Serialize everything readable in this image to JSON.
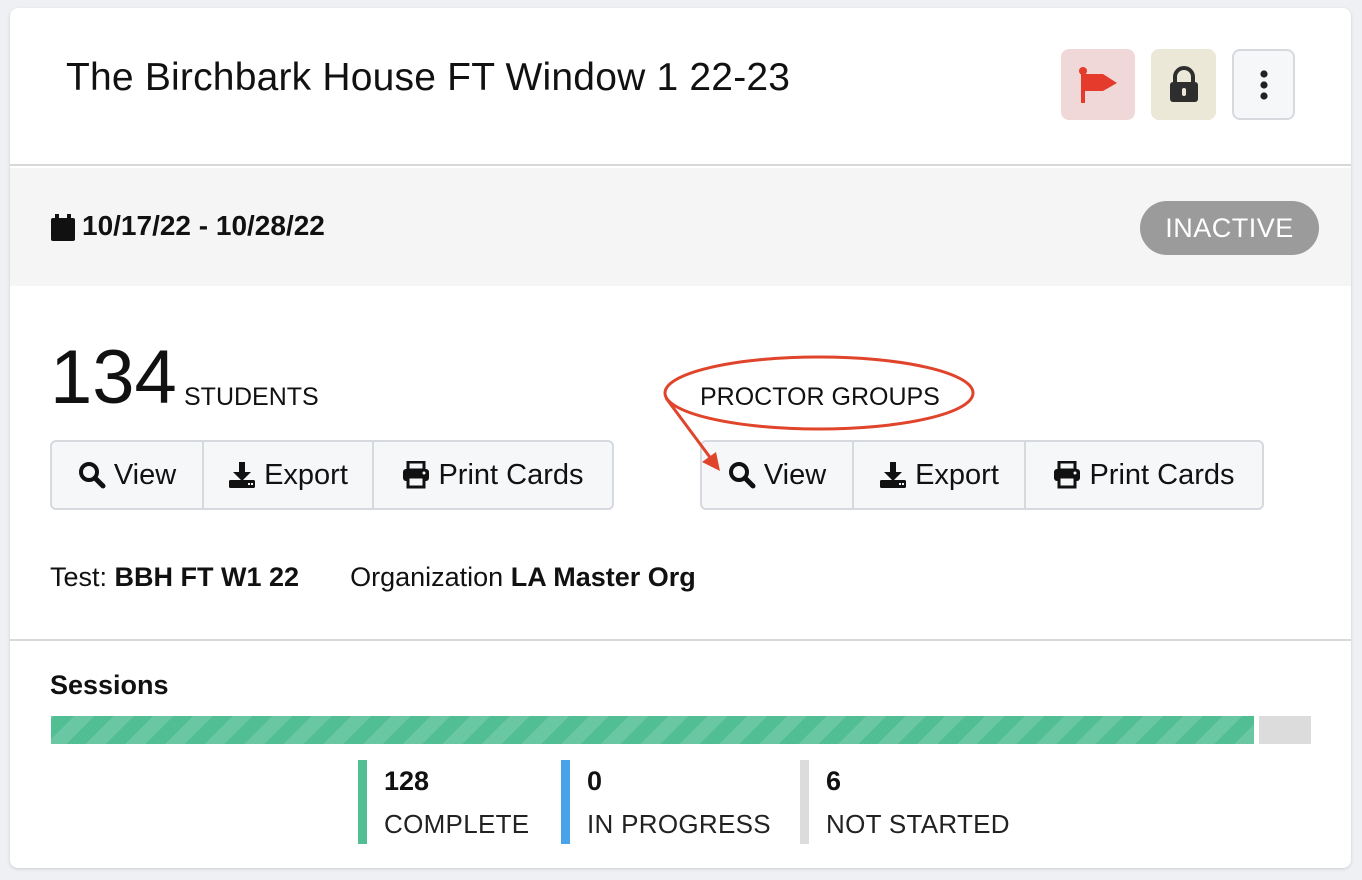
{
  "header": {
    "title": "The Birchbark House FT Window 1 22-23",
    "flag_color": "#e53b2c",
    "lock_color": "#2e2e2e"
  },
  "window": {
    "date_range": "10/17/22 - 10/28/22",
    "status": "INACTIVE"
  },
  "students": {
    "count": "134",
    "label": "STUDENTS",
    "buttons": {
      "view": "View",
      "export": "Export",
      "print": "Print Cards"
    }
  },
  "proctor_groups": {
    "label": "PROCTOR GROUPS",
    "buttons": {
      "view": "View",
      "export": "Export",
      "print": "Print Cards"
    }
  },
  "meta": {
    "test_label": "Test:",
    "test_value": "BBH FT W1 22",
    "org_label": "Organization",
    "org_value": "LA Master Org"
  },
  "sessions": {
    "title": "Sessions",
    "progress_complete_fraction": 0.955,
    "colors": {
      "complete": "#52be94",
      "in_progress": "#4aa3e8",
      "not_started": "#dcdcdc"
    },
    "stats": [
      {
        "value": "128",
        "label": "COMPLETE"
      },
      {
        "value": "0",
        "label": "IN PROGRESS"
      },
      {
        "value": "6",
        "label": "NOT STARTED"
      }
    ]
  },
  "annotation_color": "#e0442b"
}
